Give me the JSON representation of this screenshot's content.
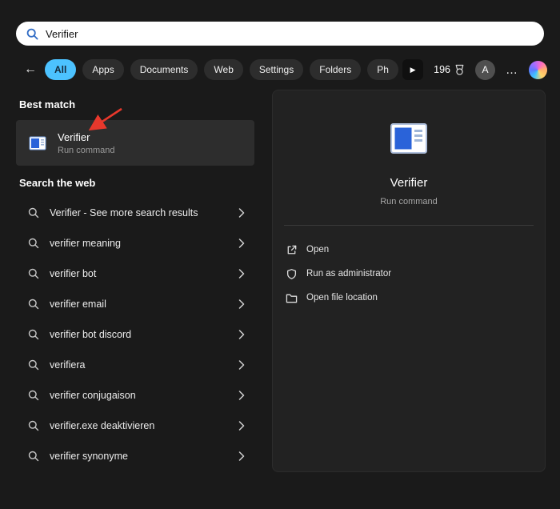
{
  "colors": {
    "accent_blue": "#4cc2ff",
    "arrow_red": "#e8382c",
    "searchbar_bg": "#ffffff",
    "item_highlight": "#2d2d2d",
    "panel_bg": "#222222",
    "app_icon_blue": "#2a63d9"
  },
  "search": {
    "value": "Verifier"
  },
  "filters": {
    "back_glyph": "←",
    "items": [
      {
        "label": "All",
        "active": true
      },
      {
        "label": "Apps",
        "active": false
      },
      {
        "label": "Documents",
        "active": false
      },
      {
        "label": "Web",
        "active": false
      },
      {
        "label": "Settings",
        "active": false
      },
      {
        "label": "Folders",
        "active": false
      },
      {
        "label": "Ph",
        "active": false
      }
    ],
    "play_glyph": "▶",
    "rewards_count": "196",
    "avatar_letter": "A",
    "more_glyph": "…"
  },
  "best_match": {
    "heading": "Best match",
    "result": {
      "title": "Verifier",
      "subtitle": "Run command",
      "icon": "verifier-app-icon"
    }
  },
  "web_search": {
    "heading": "Search the web",
    "items": [
      {
        "label": "Verifier - See more search results"
      },
      {
        "label": "verifier meaning"
      },
      {
        "label": "verifier bot"
      },
      {
        "label": "verifier email"
      },
      {
        "label": "verifier bot discord"
      },
      {
        "label": "verifiera"
      },
      {
        "label": "verifier conjugaison"
      },
      {
        "label": "verifier.exe deaktivieren"
      },
      {
        "label": "verifier synonyme"
      }
    ]
  },
  "preview": {
    "title": "Verifier",
    "subtitle": "Run command",
    "icon": "verifier-app-icon",
    "actions": [
      {
        "label": "Open",
        "icon": "open-icon"
      },
      {
        "label": "Run as administrator",
        "icon": "shield-icon"
      },
      {
        "label": "Open file location",
        "icon": "folder-icon"
      }
    ]
  }
}
